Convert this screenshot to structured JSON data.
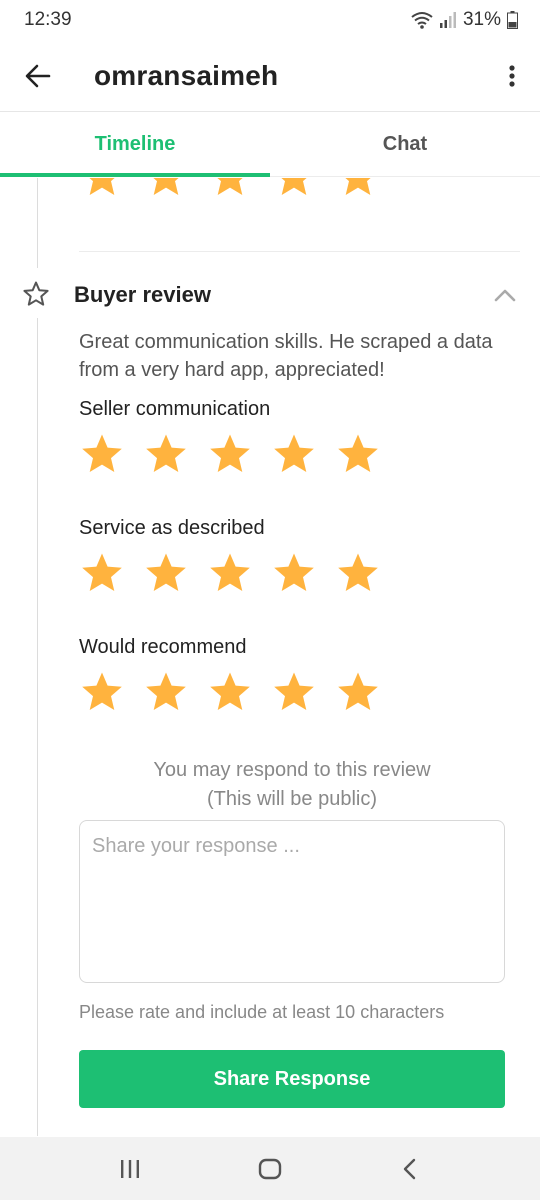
{
  "status_bar": {
    "time": "12:39",
    "battery": "31%"
  },
  "app_bar": {
    "title": "omransaimeh"
  },
  "tabs": [
    {
      "label": "Timeline",
      "active": true
    },
    {
      "label": "Chat",
      "active": false
    }
  ],
  "review": {
    "title": "Buyer review",
    "text": "Great communication skills. He scraped a data from a very hard app, appreciated!",
    "previous_rating": 5,
    "ratings": [
      {
        "label": "Seller communication",
        "stars": 5
      },
      {
        "label": "Service as described",
        "stars": 5
      },
      {
        "label": "Would recommend",
        "stars": 5
      }
    ]
  },
  "response": {
    "note_line1": "You may respond to this review",
    "note_line2": "(This will be public)",
    "placeholder": "Share your response ...",
    "hint": "Please rate and include at least 10 characters",
    "button_label": "Share Response"
  },
  "colors": {
    "accent": "#1dbf73",
    "star": "#ffb33e"
  }
}
